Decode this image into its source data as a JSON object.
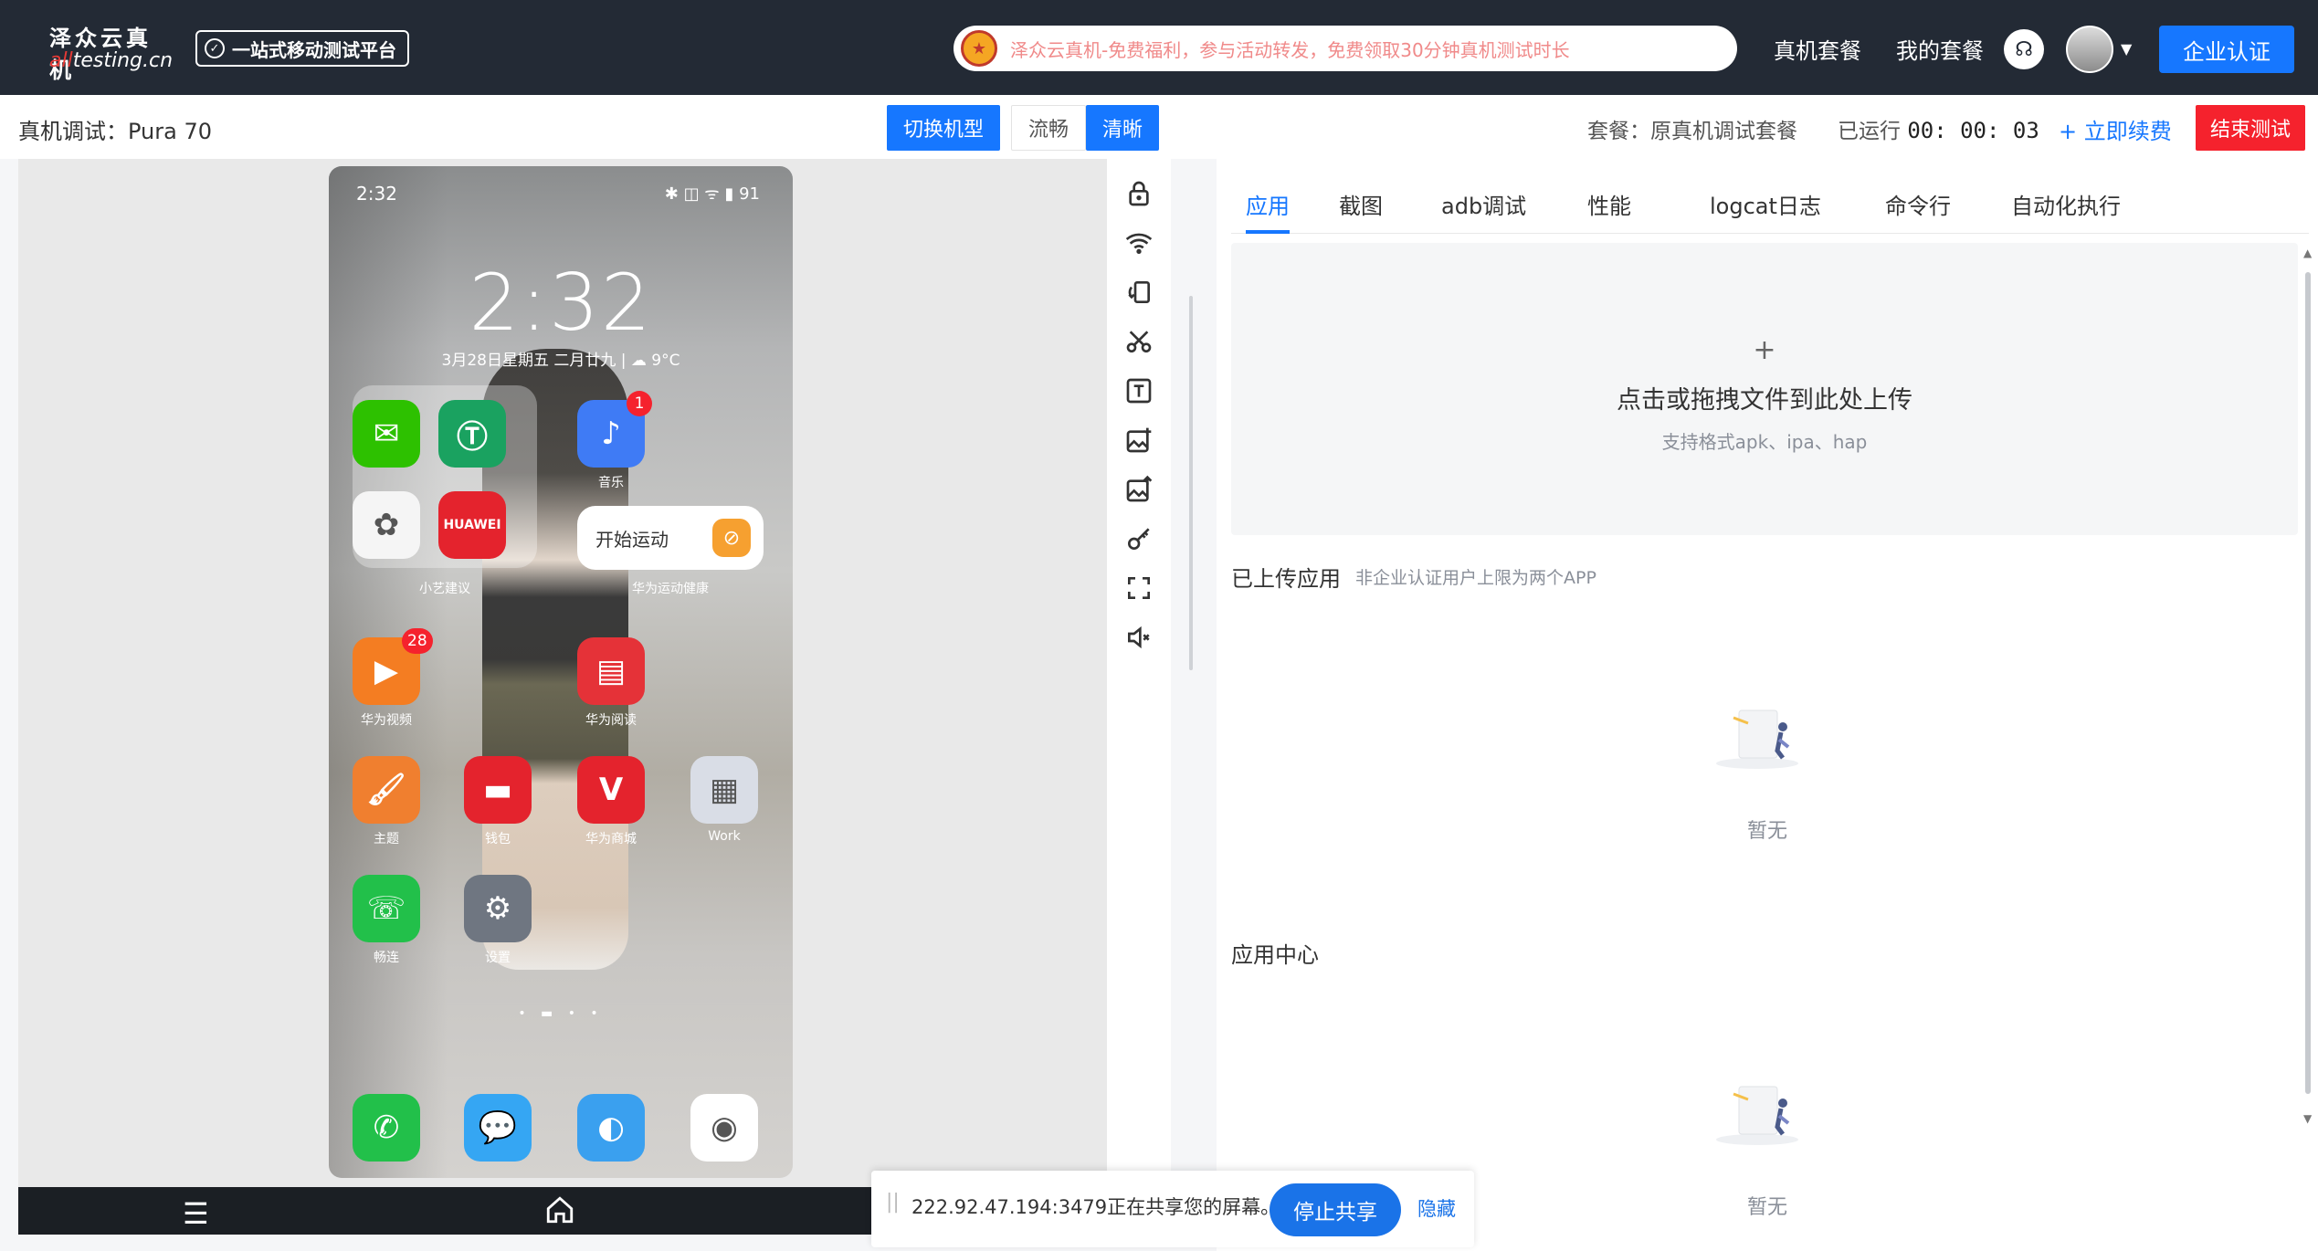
{
  "header": {
    "logo_cn": "泽众云真机",
    "logo_en_accent": "all",
    "logo_en_rest": "testing.cn",
    "platform_badge": "一站式移动测试平台",
    "notice_text": "泽众云真机-免费福利，参与活动转发，免费领取30分钟真机测试时长",
    "nav": [
      "真机套餐",
      "我的套餐"
    ],
    "enterprise_button": "企业认证"
  },
  "subbar": {
    "device_title": "真机调试：Pura 70",
    "switch_model": "切换机型",
    "quality_smooth": "流畅",
    "quality_hd": "清晰",
    "package_label": "套餐：原真机调试套餐",
    "running_label": "已运行",
    "running_time": "00: 00: 03",
    "renew": "+ 立即续费",
    "end_test": "结束测试"
  },
  "phone": {
    "status_time": "2:32",
    "status_icons": "✱ ◫ ᯤ ▮ 91",
    "clock": "2:32",
    "date": "3月28日星期五  二月廿九  |  ☁ 9°C",
    "folder_label": "小艺建议",
    "widget_text": "开始运动",
    "widget_label": "华为运动健康",
    "apps": [
      {
        "label": "",
        "glyph": "✉",
        "color": "#2dc100"
      },
      {
        "label": "",
        "glyph": "Ⓣ",
        "color": "#1aa260"
      },
      {
        "label": "音乐",
        "glyph": "♪",
        "color": "#3f7bf5",
        "badge": "1"
      },
      {
        "label": "",
        "glyph": "✿",
        "color": "#f5f5f5"
      },
      {
        "label": "",
        "glyph": "HUAWEI",
        "color": "#e4232d"
      },
      {
        "label": "华为视频",
        "glyph": "▶",
        "color": "#f47d22",
        "badge": "28"
      },
      {
        "label": "华为阅读",
        "glyph": "▤",
        "color": "#e53238"
      },
      {
        "label": "主题",
        "glyph": "🖌",
        "color": "#f07f2f"
      },
      {
        "label": "钱包",
        "glyph": "▬",
        "color": "#e4232d"
      },
      {
        "label": "华为商城",
        "glyph": "V",
        "color": "#e4232d"
      },
      {
        "label": "Work",
        "glyph": "▦",
        "color": "#d9dde6"
      },
      {
        "label": "畅连",
        "glyph": "☏",
        "color": "#22c04a"
      },
      {
        "label": "设置",
        "glyph": "⚙",
        "color": "#6f7681"
      },
      {
        "label": "",
        "glyph": "✆",
        "color": "#22c04a"
      },
      {
        "label": "",
        "glyph": "💬",
        "color": "#35a6f3"
      },
      {
        "label": "",
        "glyph": "◐",
        "color": "#3aa0ef"
      },
      {
        "label": "",
        "glyph": "◉",
        "color": "#ffffff"
      }
    ]
  },
  "device_nav": {
    "menu": "☰"
  },
  "tabs": [
    "应用",
    "截图",
    "adb调试",
    "性能",
    "logcat日志",
    "命令行",
    "自动化执行"
  ],
  "upload": {
    "plus": "+",
    "main_text": "点击或拖拽文件到此处上传",
    "hint": "支持格式apk、ipa、hap"
  },
  "uploaded_apps": {
    "title": "已上传应用",
    "note": "非企业认证用户上限为两个APP",
    "empty": "暂无"
  },
  "app_center": {
    "title": "应用中心",
    "empty": "暂无"
  },
  "share_bar": {
    "grip": "||",
    "text": "222.92.47.194:3479正在共享您的屏幕。",
    "stop": "停止共享",
    "hide": "隐藏"
  },
  "colors": {
    "primary": "#1677ff",
    "danger": "#f5222d",
    "header_bg": "#232a35"
  }
}
